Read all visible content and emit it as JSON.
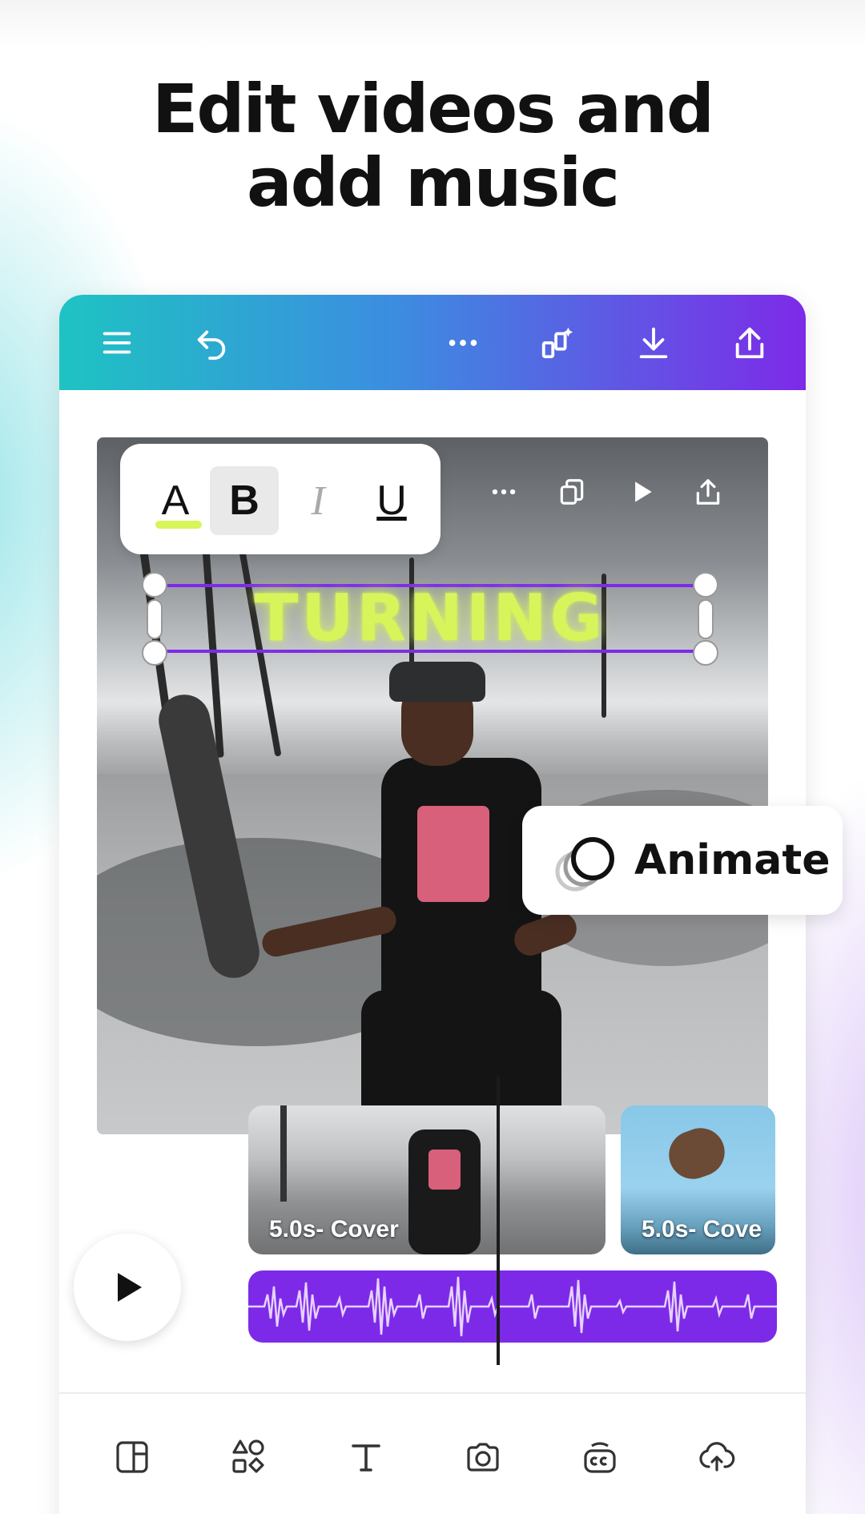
{
  "headline": {
    "line1": "Edit videos and",
    "line2": "add music"
  },
  "topbar": {
    "icons": [
      "menu-icon",
      "undo-icon",
      "more-icon",
      "magic-resize-icon",
      "download-icon",
      "share-icon"
    ],
    "gradient": [
      "#1ec3c3",
      "#7d2ae8"
    ]
  },
  "format_bar": {
    "color_label": "A",
    "bold_label": "B",
    "italic_label": "I",
    "underline_label": "U"
  },
  "element_tools": [
    "more-icon",
    "duplicate-icon",
    "play-icon",
    "export-icon"
  ],
  "canvas": {
    "selected_text": "TURNING",
    "text_color": "#d7f55b"
  },
  "animate": {
    "label": "Animate"
  },
  "timeline": {
    "clips": [
      {
        "label": "5.0s- Cover"
      },
      {
        "label": "5.0s- Cove"
      }
    ],
    "audio_color": "#7d2ae8"
  },
  "bottom_toolbar": {
    "icons": [
      "design-icon",
      "elements-icon",
      "text-icon",
      "camera-icon",
      "apps-icon",
      "upload-icon"
    ]
  }
}
